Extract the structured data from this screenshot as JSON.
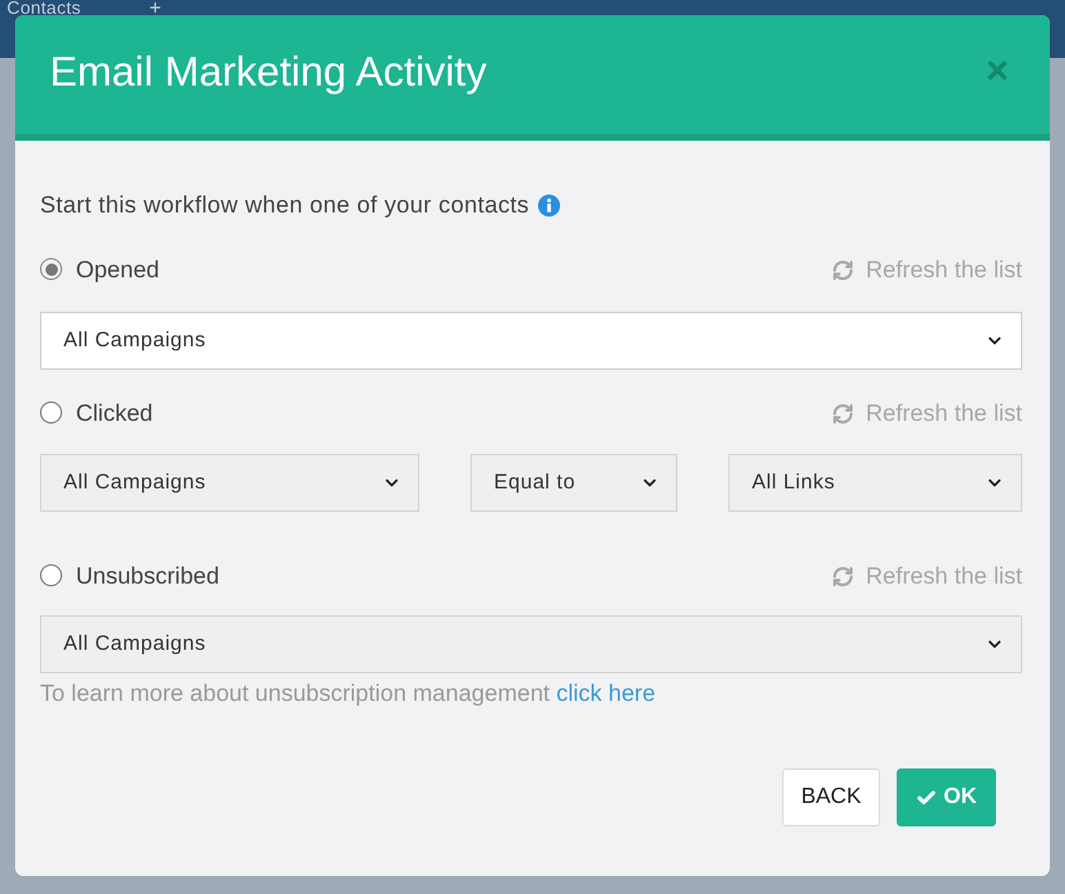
{
  "background": {
    "header_title": "Contacts"
  },
  "dialog": {
    "title": "Email Marketing Activity",
    "intro": "Start this workflow when one of your contacts"
  },
  "triggers": [
    {
      "label": "Opened",
      "selected": true,
      "refresh": "Refresh the list",
      "selects": [
        {
          "value": "All Campaigns",
          "disabled": false
        }
      ]
    },
    {
      "label": "Clicked",
      "selected": false,
      "refresh": "Refresh the list",
      "selects": [
        {
          "value": "All Campaigns",
          "disabled": true
        },
        {
          "value": "Equal to",
          "disabled": true
        },
        {
          "value": "All Links",
          "disabled": true
        }
      ]
    },
    {
      "label": "Unsubscribed",
      "selected": false,
      "refresh": "Refresh the list",
      "selects": [
        {
          "value": "All Campaigns",
          "disabled": true
        }
      ],
      "note": "To learn more about unsubscription management",
      "note_link": "click here"
    }
  ],
  "buttons": [
    {
      "label": "BACK",
      "kind": "secondary"
    },
    {
      "label": "OK",
      "kind": "primary"
    }
  ]
}
